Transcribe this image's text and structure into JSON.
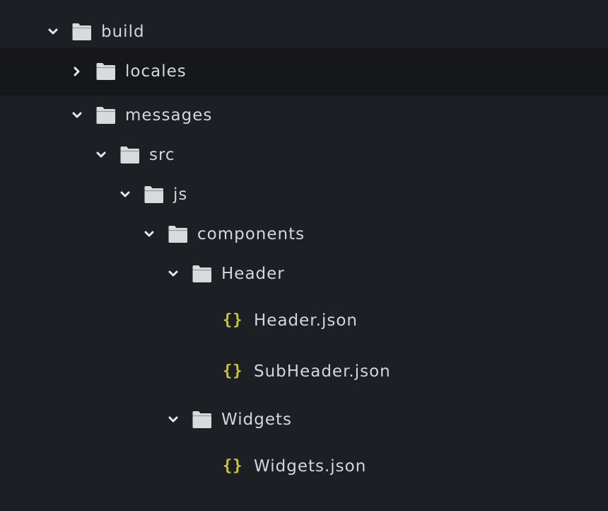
{
  "tree": [
    {
      "label": "build",
      "type": "folder",
      "state": "expanded",
      "depth": 0
    },
    {
      "label": "locales",
      "type": "folder",
      "state": "collapsed",
      "depth": 1,
      "selected": true
    },
    {
      "label": "messages",
      "type": "folder",
      "state": "expanded",
      "depth": 1
    },
    {
      "label": "src",
      "type": "folder",
      "state": "expanded",
      "depth": 2
    },
    {
      "label": "js",
      "type": "folder",
      "state": "expanded",
      "depth": 3
    },
    {
      "label": "components",
      "type": "folder",
      "state": "expanded",
      "depth": 4
    },
    {
      "label": "Header",
      "type": "folder",
      "state": "expanded",
      "depth": 5
    },
    {
      "label": "Header.json",
      "type": "file",
      "icon": "json-braces-icon",
      "depth": 6
    },
    {
      "label": "SubHeader.json",
      "type": "file",
      "icon": "json-braces-icon",
      "depth": 6
    },
    {
      "label": "Widgets",
      "type": "folder",
      "state": "expanded",
      "depth": 5
    },
    {
      "label": "Widgets.json",
      "type": "file",
      "icon": "json-braces-icon",
      "depth": 6
    }
  ],
  "colors": {
    "background": "#1c1f23",
    "selected_row": "#151719",
    "text": "#d4d6d9",
    "folder_icon": "#d9dadc",
    "chevron": "#e6e7e9",
    "json_icon": "#cbc445"
  }
}
